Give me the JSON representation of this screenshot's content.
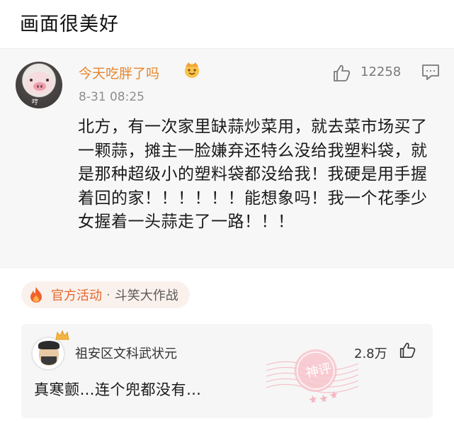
{
  "headline": "画面很美好",
  "post": {
    "username": "今天吃胖了吗",
    "avatar_tag": "哼",
    "timestamp": "8-31 08:25",
    "like_count": "12258",
    "text": "北方，有一次家里缺蒜炒菜用，就去菜市场买了一颗蒜，摊主一脸嫌弃还特么没给我塑料袋，就是那种超级小的塑料袋都没给我！我硬是用手握着回的家！！！！！！能想象吗！我一个花季少女握着一头蒜走了一路！！！",
    "icons": {
      "badge": "crown-emoji-icon",
      "like": "thumbs-up-icon",
      "comment": "comment-icon"
    }
  },
  "event": {
    "label": "官方活动",
    "separator": "·",
    "name": "斗笑大作战",
    "icon": "fire-icon",
    "accent": "#e2682f"
  },
  "hot_comment": {
    "username": "祖安区文科武状元",
    "like_count": "2.8万",
    "text": "真寒颤…连个兜都没有…",
    "stamp_text": "神评",
    "icons": {
      "avatar_badge": "crown-icon",
      "like": "thumbs-up-icon",
      "stamp": "shenping-stamp-icon"
    }
  },
  "colors": {
    "username": "#e8852b",
    "stamp": "#f4b6c0",
    "background": "#f7f7f7"
  }
}
